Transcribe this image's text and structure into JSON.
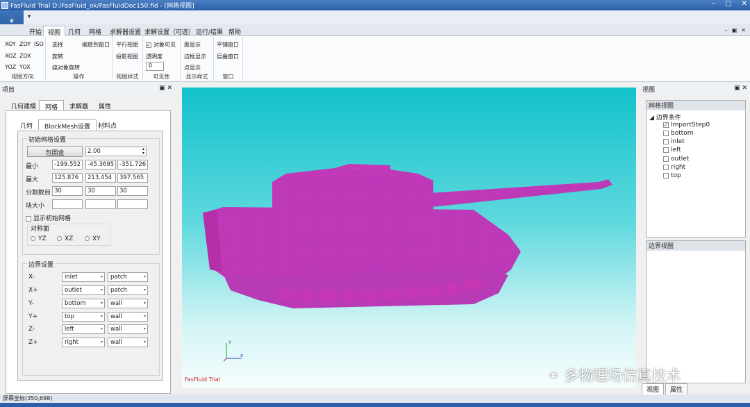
{
  "window": {
    "title": "FasFluid Trial D:/FasFluid_ok/FasFluidDoc150.fld - [网格视图]"
  },
  "ribbon_tabs": [
    "开始",
    "视图",
    "几何",
    "网格",
    "求解器设置",
    "求解设置（可选）",
    "运行/结果",
    "帮助"
  ],
  "ribbon": {
    "view_direction": {
      "items": [
        "XOY",
        "ZOY",
        "ISO",
        "XOZ",
        "ZOX",
        "YOZ",
        "YOX"
      ],
      "label": "视图方向"
    },
    "operation": {
      "select": "选择",
      "zoom_window": "缩放到窗口",
      "rotate": "旋转",
      "rotate_object": "绕对象旋转",
      "label": "操作"
    },
    "view_style": {
      "parallel": "平行视图",
      "projection": "投影视图",
      "label": "视图样式"
    },
    "visibility": {
      "object_visible": "对象可见",
      "transparency": "透明度",
      "transparency_value": "0",
      "label": "可见性"
    },
    "display_style": {
      "face": "面显示",
      "edge": "边框显示",
      "point": "点显示",
      "label": "显示样式"
    },
    "window": {
      "tile": "平铺窗口",
      "cascade": "层叠窗口",
      "label": "窗口"
    }
  },
  "left_panel": {
    "title": "项目",
    "tabs": [
      "几何建模",
      "网格",
      "求解器",
      "属性"
    ],
    "subtabs": [
      "几何",
      "BlockMesh设置",
      "材料点"
    ],
    "initial_mesh": {
      "group": "初始网格设置",
      "bbox_button": "包围盒",
      "scale": "2.00",
      "min_label": "最小",
      "min": [
        "-199.552",
        "-45.3695",
        "-351.726"
      ],
      "max_label": "最大",
      "max": [
        "125.876",
        "213.454",
        "397.565"
      ],
      "divisions_label": "分割数目",
      "divisions": [
        "30",
        "30",
        "30"
      ],
      "block_size_label": "块大小",
      "show_initial_mesh": "显示初始网格",
      "symmetry_label": "对称面",
      "symmetry_options": [
        "YZ",
        "XZ",
        "XY"
      ]
    },
    "boundary": {
      "group": "边界设置",
      "rows": [
        {
          "axis": "X-",
          "name": "inlet",
          "type": "patch"
        },
        {
          "axis": "X+",
          "name": "outlet",
          "type": "patch"
        },
        {
          "axis": "Y-",
          "name": "bottom",
          "type": "wall"
        },
        {
          "axis": "Y+",
          "name": "top",
          "type": "wall"
        },
        {
          "axis": "Z-",
          "name": "left",
          "type": "wall"
        },
        {
          "axis": "Z+",
          "name": "right",
          "type": "wall"
        }
      ]
    }
  },
  "viewport": {
    "watermark": "FasFluid Trial",
    "axis_y": "y",
    "axis_x": "x"
  },
  "right_panel": {
    "title": "视图",
    "mesh_view": "网格视图",
    "boundary_conditions": "边界条件",
    "items": [
      "ImportStep0",
      "bottom",
      "inlet",
      "left",
      "outlet",
      "right",
      "top"
    ],
    "boundary_view": "边界视图",
    "bottom_tabs": [
      "视图",
      "属性"
    ]
  },
  "statusbar": {
    "coords": "屏幕坐标(350,698)"
  },
  "overlay": {
    "wechat_watermark": "多物理场仿真技术"
  },
  "colors": {
    "mesh": "#c637b6",
    "viewport_top": "#12c2cc"
  }
}
